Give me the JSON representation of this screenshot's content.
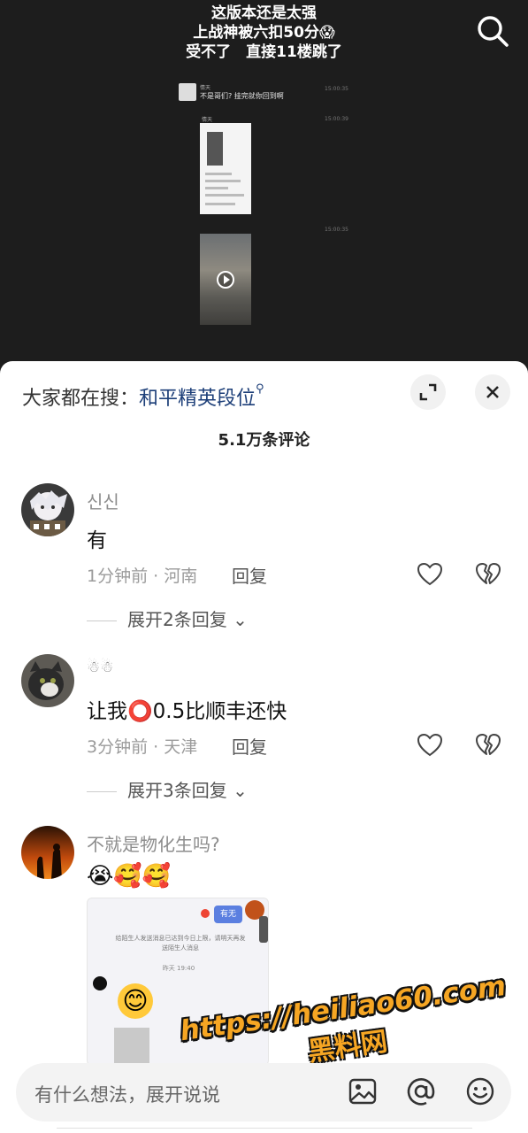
{
  "video": {
    "caption_lines": [
      "这版本还是太强",
      "上战神被六扣50分😱",
      "受不了　直接11楼跳了"
    ],
    "chat": {
      "name": "情天",
      "message": "不是哥们?  挂完就你回到啊",
      "time1": "15:00:35",
      "time2": "15:00:39",
      "time3": "15:00:35"
    }
  },
  "sheet": {
    "hot_search_prefix": "大家都在搜：",
    "hot_search_keyword": "和平精英段位",
    "comment_count": "5.1万条评论"
  },
  "comments": [
    {
      "username": "신신",
      "text": "有",
      "time_location": "1分钟前 · 河南",
      "reply_label": "回复",
      "expand_label": "展开2条回复"
    },
    {
      "username": "☃☃",
      "text": "让我⭕0.5比顺丰还快",
      "time_location": "3分钟前 · 天津",
      "reply_label": "回复",
      "expand_label": "展开3条回复"
    },
    {
      "username": "不就是物化生吗?",
      "text": "😭🥰🥰",
      "screenshot": {
        "button": "有无",
        "notice": "给陌生人发送消息已达到今日上限，请明天再发送陌生人消息",
        "time": "昨天 19:40"
      }
    }
  ],
  "input": {
    "placeholder": "有什么想法，展开说说"
  },
  "watermark": {
    "line1": "https://heiliao60.com",
    "line2": "黑料网"
  },
  "icons": {
    "search": "search-icon",
    "expand": "expand-icon",
    "close": "close-icon",
    "like": "heart-icon",
    "dislike": "broken-heart-icon",
    "image": "image-icon",
    "mention": "at-icon",
    "emoji": "emoji-icon"
  }
}
